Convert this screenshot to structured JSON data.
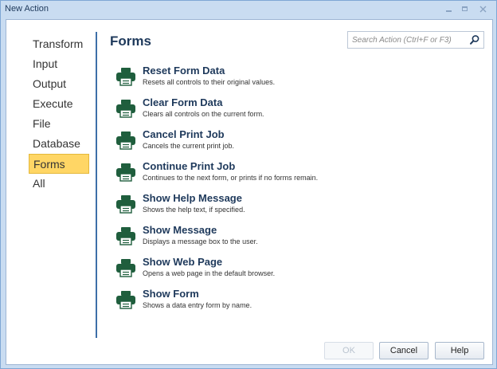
{
  "window": {
    "title": "New Action"
  },
  "sidebar": {
    "items": [
      {
        "label": "Transform"
      },
      {
        "label": "Input"
      },
      {
        "label": "Output"
      },
      {
        "label": "Execute"
      },
      {
        "label": "File"
      },
      {
        "label": "Database"
      },
      {
        "label": "Forms",
        "active": true
      },
      {
        "label": "All"
      }
    ]
  },
  "main": {
    "heading": "Forms",
    "search": {
      "placeholder": "Search Action (Ctrl+F or F3)"
    },
    "actions": [
      {
        "title": "Reset Form Data",
        "desc": "Resets all controls to their original values.",
        "icon": "printer-icon"
      },
      {
        "title": "Clear Form Data",
        "desc": "Clears all controls on the current form.",
        "icon": "printer-icon"
      },
      {
        "title": "Cancel Print Job",
        "desc": "Cancels the current print job.",
        "icon": "printer-icon"
      },
      {
        "title": "Continue Print Job",
        "desc": "Continues to the next form, or prints if no forms remain.",
        "icon": "printer-icon"
      },
      {
        "title": "Show Help Message",
        "desc": "Shows the help text, if specified.",
        "icon": "printer-icon"
      },
      {
        "title": "Show Message",
        "desc": "Displays a message box to the user.",
        "icon": "printer-icon"
      },
      {
        "title": "Show Web Page",
        "desc": "Opens a web page in the default browser.",
        "icon": "printer-icon"
      },
      {
        "title": "Show Form",
        "desc": "Shows a data entry form by name.",
        "icon": "printer-icon"
      }
    ]
  },
  "buttons": {
    "ok": "OK",
    "cancel": "Cancel",
    "help": "Help",
    "ok_disabled": true
  },
  "colors": {
    "accent": "#1e395b",
    "icon_green": "#1f5e3d",
    "active_bg": "#ffd665",
    "divider": "#3d6fa8"
  }
}
